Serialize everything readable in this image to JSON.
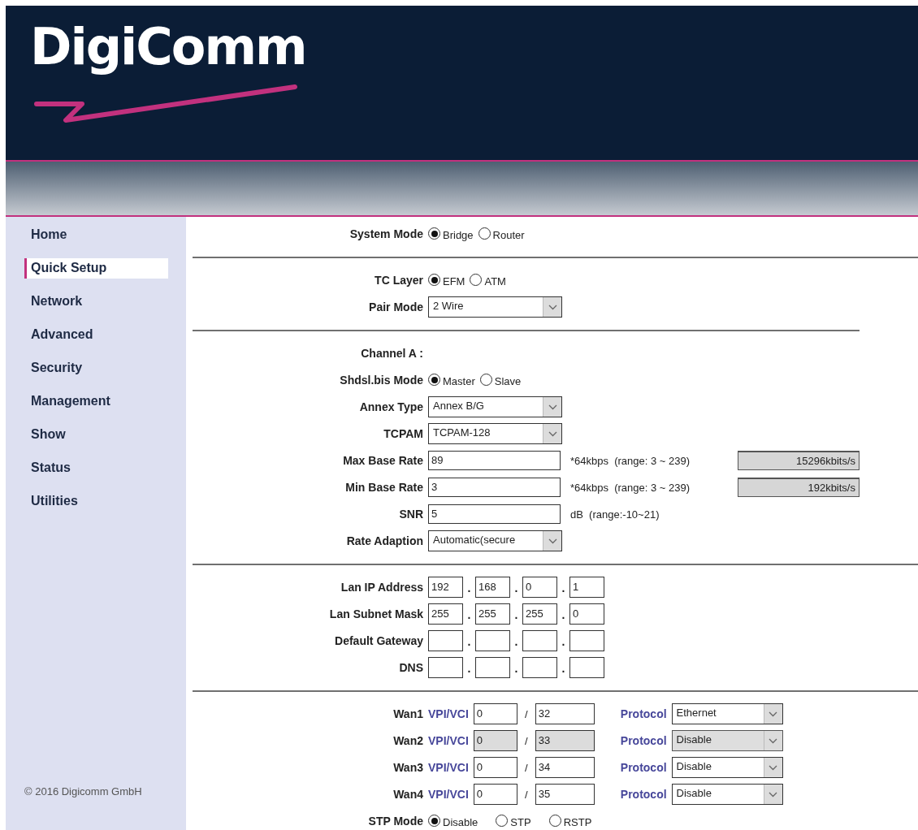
{
  "logo": {
    "text": "DigiComm"
  },
  "sidebar": {
    "items": [
      {
        "label": "Home",
        "selected": false
      },
      {
        "label": "Quick Setup",
        "selected": true
      },
      {
        "label": "Network",
        "selected": false
      },
      {
        "label": "Advanced",
        "selected": false
      },
      {
        "label": "Security",
        "selected": false
      },
      {
        "label": "Management",
        "selected": false
      },
      {
        "label": "Show",
        "selected": false
      },
      {
        "label": "Status",
        "selected": false
      },
      {
        "label": "Utilities",
        "selected": false
      }
    ],
    "footer": "© 2016 Digicomm GmbH"
  },
  "sections": [
    {
      "rows": [
        {
          "kind": "radio",
          "label": "System Mode",
          "options": [
            {
              "label": "Bridge",
              "selected": true
            },
            {
              "label": "Router",
              "selected": false
            }
          ]
        }
      ]
    },
    {
      "rows": [
        {
          "kind": "radio",
          "label": "TC Layer",
          "options": [
            {
              "label": "EFM",
              "selected": true
            },
            {
              "label": "ATM",
              "selected": false
            }
          ]
        },
        {
          "kind": "select",
          "label": "Pair Mode",
          "value": "2 Wire"
        }
      ]
    },
    {
      "rows": [
        {
          "kind": "heading",
          "label": "Channel A :"
        },
        {
          "kind": "radio",
          "label": "Shdsl.bis Mode",
          "options": [
            {
              "label": "Master",
              "selected": true
            },
            {
              "label": "Slave",
              "selected": false
            }
          ]
        },
        {
          "kind": "select",
          "label": "Annex Type",
          "value": "Annex B/G"
        },
        {
          "kind": "select",
          "label": "TCPAM",
          "value": "TCPAM-128"
        },
        {
          "kind": "input",
          "label": "Max Base Rate",
          "value": "89",
          "note": "*64kbps  (range: 3 ~ 239)",
          "readout": "15296kbits/s"
        },
        {
          "kind": "input",
          "label": "Min Base Rate",
          "value": "3",
          "note": "*64kbps  (range: 3 ~ 239)",
          "readout": "192kbits/s"
        },
        {
          "kind": "input",
          "label": "SNR",
          "value": "5",
          "note": "dB  (range:-10~21)"
        },
        {
          "kind": "select",
          "label": "Rate Adaption",
          "value": "Automatic(secure"
        }
      ]
    },
    {
      "rows": [
        {
          "kind": "ip",
          "label": "Lan IP Address",
          "octets": [
            "192",
            "168",
            "0",
            "1"
          ],
          "separators": [
            ".",
            ".",
            "."
          ]
        },
        {
          "kind": "ip",
          "label": "Lan Subnet Mask",
          "octets": [
            "255",
            "255",
            "255",
            "0"
          ],
          "separators": [
            ".",
            ".",
            "."
          ]
        },
        {
          "kind": "ip",
          "label": "Default Gateway",
          "separators": [
            ".",
            ".",
            "."
          ]
        },
        {
          "kind": "ip",
          "label": "DNS",
          "separators": [
            ".",
            ".",
            "."
          ]
        }
      ]
    },
    {
      "rows": [
        {
          "kind": "wan",
          "label": "Wan1",
          "id_label": "VPI/VCI",
          "vpi": "0",
          "slash": "/",
          "vci": "32",
          "protocol_label": "Protocol",
          "protocol": "Ethernet",
          "disabled": false
        },
        {
          "kind": "wan",
          "label": "Wan2",
          "id_label": "VPI/VCI",
          "vpi": "0",
          "slash": "/",
          "vci": "33",
          "protocol_label": "Protocol",
          "protocol": "Disable",
          "disabled": true
        },
        {
          "kind": "wan",
          "label": "Wan3",
          "id_label": "VPI/VCI",
          "vpi": "0",
          "slash": "/",
          "vci": "34",
          "protocol_label": "Protocol",
          "protocol": "Disable",
          "disabled": false
        },
        {
          "kind": "wan",
          "label": "Wan4",
          "id_label": "VPI/VCI",
          "vpi": "0",
          "slash": "/",
          "vci": "35",
          "protocol_label": "Protocol",
          "protocol": "Disable",
          "disabled": false
        },
        {
          "kind": "radio",
          "label": "STP Mode",
          "options": [
            {
              "label": "Disable",
              "selected": true
            },
            {
              "label": "STP",
              "selected": false
            },
            {
              "label": "RSTP",
              "selected": false
            }
          ]
        }
      ]
    }
  ]
}
